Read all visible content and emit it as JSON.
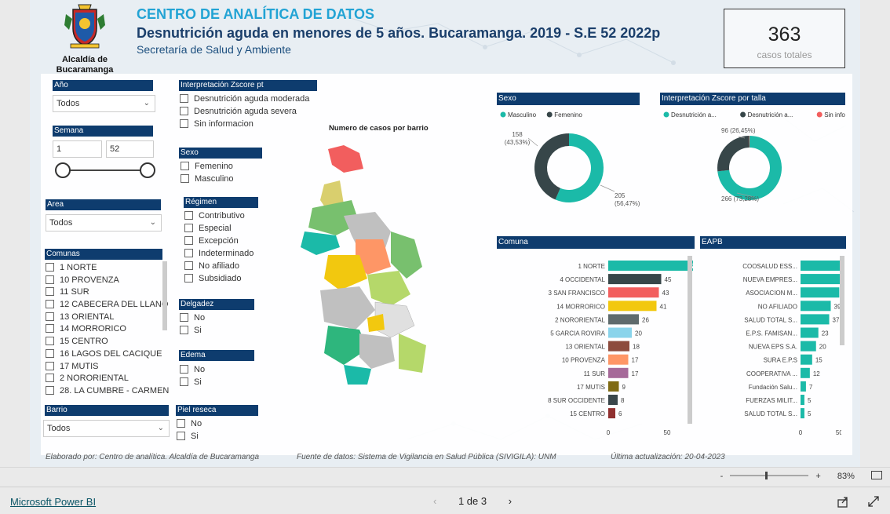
{
  "header": {
    "title": "CENTRO DE ANALÍTICA DE DATOS",
    "subtitle": "Desnutrición aguda en menores de 5 años. Bucaramanga. 2019 - S.E 52 2022p",
    "department": "Secretaría de Salud y Ambiente",
    "logo_text_1": "Alcaldía de",
    "logo_text_2": "Bucaramanga"
  },
  "kpi": {
    "value": "363",
    "label": "casos totales"
  },
  "filters": {
    "anio": {
      "label": "Año",
      "value": "Todos"
    },
    "semana": {
      "label": "Semana",
      "from": "1",
      "to": "52"
    },
    "area": {
      "label": "Area",
      "value": "Todos"
    },
    "comunas": {
      "label": "Comunas",
      "items": [
        "1 NORTE",
        "10 PROVENZA",
        "11 SUR",
        "12 CABECERA DEL LLANO",
        "13 ORIENTAL",
        "14 MORRORICO",
        "15 CENTRO",
        "16 LAGOS DEL CACIQUE",
        "17 MUTIS",
        "2 NORORIENTAL",
        "28. LA CUMBRE - CARMEN"
      ]
    },
    "barrio": {
      "label": "Barrio",
      "value": "Todos"
    },
    "zscore_pt": {
      "label": "Interpretación Zscore pt",
      "items": [
        "Desnutrición aguda moderada",
        "Desnutrición aguda severa",
        "Sin informacion"
      ]
    },
    "sexo": {
      "label": "Sexo",
      "items": [
        "Femenino",
        "Masculino"
      ]
    },
    "regimen": {
      "label": "Régimen",
      "items": [
        "Contributivo",
        "Especial",
        "Excepción",
        "Indeterminado",
        "No afiliado",
        "Subsidiado"
      ]
    },
    "delgadez": {
      "label": "Delgadez",
      "items": [
        "No",
        "Si"
      ]
    },
    "edema": {
      "label": "Edema",
      "items": [
        "No",
        "Si"
      ]
    },
    "piel": {
      "label": "Piel reseca",
      "items": [
        "No",
        "Si"
      ]
    }
  },
  "map": {
    "title": "Numero de casos por barrio"
  },
  "chart_data": [
    {
      "type": "pie",
      "title": "Sexo",
      "labels": [
        "Masculino",
        "Femenino"
      ],
      "values": [
        205,
        158
      ],
      "data_labels": [
        "205 (56,47%)",
        "158 (43,53%)"
      ],
      "colors": [
        "#1bbaa8",
        "#374649"
      ],
      "legend": "top-left"
    },
    {
      "type": "pie",
      "title": "Interpretación Zscore por talla",
      "labels": [
        "Desnutrición a...",
        "Desnutrición a...",
        "Sin informa..."
      ],
      "values": [
        266,
        96,
        1
      ],
      "data_labels": [
        "266 (73,28%)",
        "96 (26,45%)"
      ],
      "colors": [
        "#1bbaa8",
        "#374649",
        "#f25e5e"
      ],
      "legend": "top-left"
    },
    {
      "type": "bar",
      "title": "Comuna",
      "orientation": "horizontal",
      "categories": [
        "1 NORTE",
        "4 OCCIDENTAL",
        "3 SAN FRANCISCO",
        "14 MORRORICO",
        "2 NORORIENTAL",
        "5 GARCIA ROVIRA",
        "13 ORIENTAL",
        "10 PROVENZA",
        "11 SUR",
        "17 MUTIS",
        "8 SUR OCCIDENTE",
        "15 CENTRO"
      ],
      "values": [
        79,
        45,
        43,
        41,
        26,
        20,
        18,
        17,
        17,
        9,
        8,
        6
      ],
      "colors": [
        "#1bbaa8",
        "#374649",
        "#f25e5e",
        "#f2c80f",
        "#5f6b6d",
        "#8ad4eb",
        "#8d4b3d",
        "#fe9666",
        "#a66999",
        "#7f6a13",
        "#3a474b",
        "#90302f"
      ],
      "xlim": [
        0,
        80
      ],
      "xticks": [
        0,
        50
      ]
    },
    {
      "type": "bar",
      "title": "EAPB",
      "orientation": "horizontal",
      "categories": [
        "COOSALUD ESS...",
        "NUEVA EMPRES...",
        "ASOCIACION M...",
        "NO AFILIADO",
        "SALUD TOTAL S...",
        "E.P.S. FAMISAN...",
        "NUEVA EPS S.A.",
        "SURA E.P.S",
        "COOPERATIVA ...",
        "Fundación Salu...",
        "FUERZAS MILIT...",
        "SALUD TOTAL S..."
      ],
      "values": [
        77,
        51,
        50,
        39,
        37,
        23,
        20,
        15,
        12,
        7,
        5,
        5
      ],
      "colors": [
        "#1bbaa8"
      ],
      "xlim": [
        0,
        80
      ],
      "xticks": [
        0,
        50
      ]
    }
  ],
  "footer": {
    "elaborado": "Elaborado por: Centro de analítica. Alcaldía de Bucaramanga",
    "fuente": "Fuente de datos: Sistema de Vigilancia en Salud Pública (SIVIGILA): UNM",
    "actualizacion": "Última actualización: 20-04-2023"
  },
  "zoom": {
    "minus": "-",
    "plus": "+",
    "level": "83%"
  },
  "status": {
    "app": "Microsoft Power BI",
    "page": "1 de 3"
  }
}
